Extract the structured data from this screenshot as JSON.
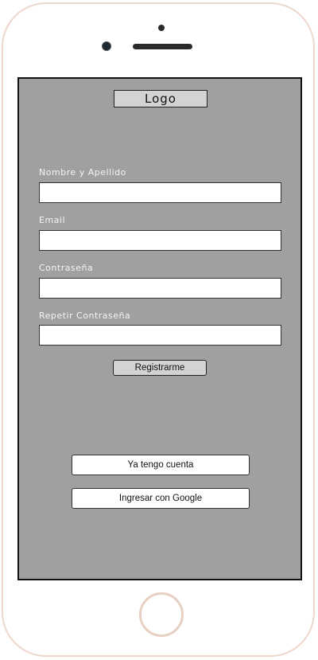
{
  "header": {
    "logo_text": "Logo"
  },
  "form": {
    "fields": [
      {
        "label": "Nombre y Apellido",
        "value": "",
        "placeholder": ""
      },
      {
        "label": "Email",
        "value": "",
        "placeholder": ""
      },
      {
        "label": "Contraseña",
        "value": "",
        "placeholder": ""
      },
      {
        "label": "Repetir Contraseña",
        "value": "",
        "placeholder": ""
      }
    ],
    "register_label": "Registrarme"
  },
  "auth": {
    "have_account_label": "Ya tengo cuenta",
    "google_label": "Ingresar con Google"
  },
  "colors": {
    "screen_background": "#a0a0a0",
    "phone_frame": "#eed7cc"
  }
}
